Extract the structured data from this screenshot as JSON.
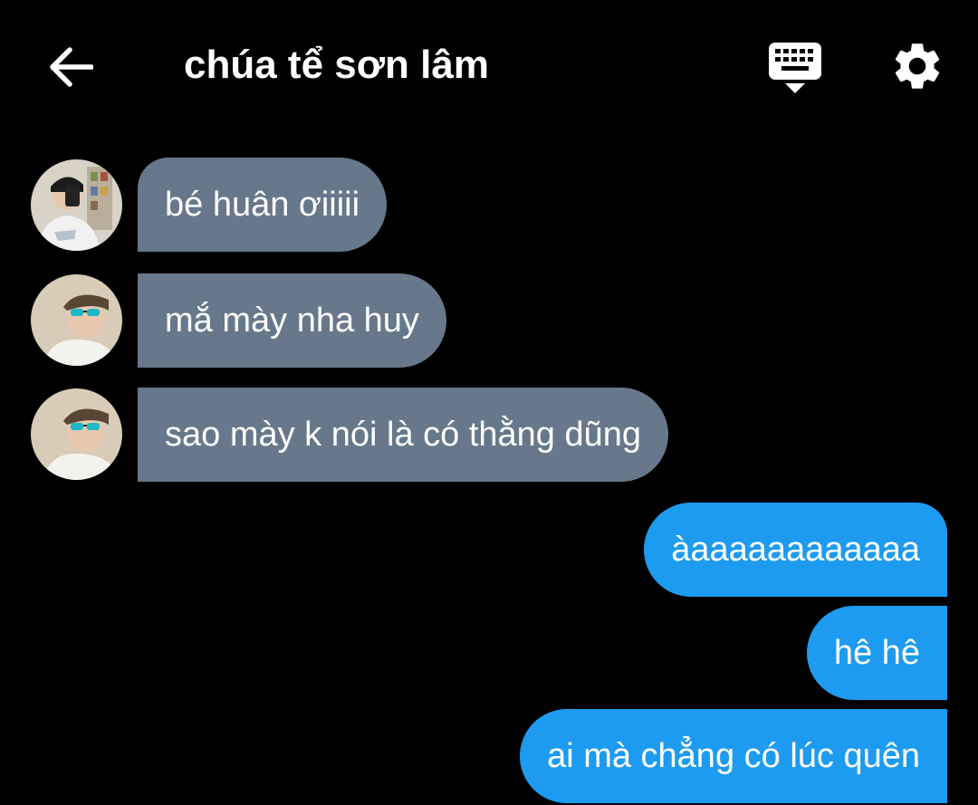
{
  "header": {
    "title": "chúa tể sơn lâm",
    "back_icon": "arrow-left-icon",
    "keyboard_icon": "keyboard-hide-icon",
    "settings_icon": "gear-icon"
  },
  "messages": [
    {
      "direction": "incoming",
      "text": "bé huân ơiiiii"
    },
    {
      "direction": "incoming",
      "text": "mắ mày nha huy"
    },
    {
      "direction": "incoming",
      "text": "sao mày k nói là có thằng dũng"
    },
    {
      "direction": "outgoing",
      "text": "àaaaaaaaaaaaa"
    },
    {
      "direction": "outgoing",
      "text": "hê hê"
    },
    {
      "direction": "outgoing",
      "text": "ai mà chẳng có lúc quên"
    }
  ],
  "colors": {
    "background": "#000000",
    "incoming_bubble": "#66788a",
    "outgoing_bubble": "#1d9bf0",
    "text": "#ffffff"
  }
}
